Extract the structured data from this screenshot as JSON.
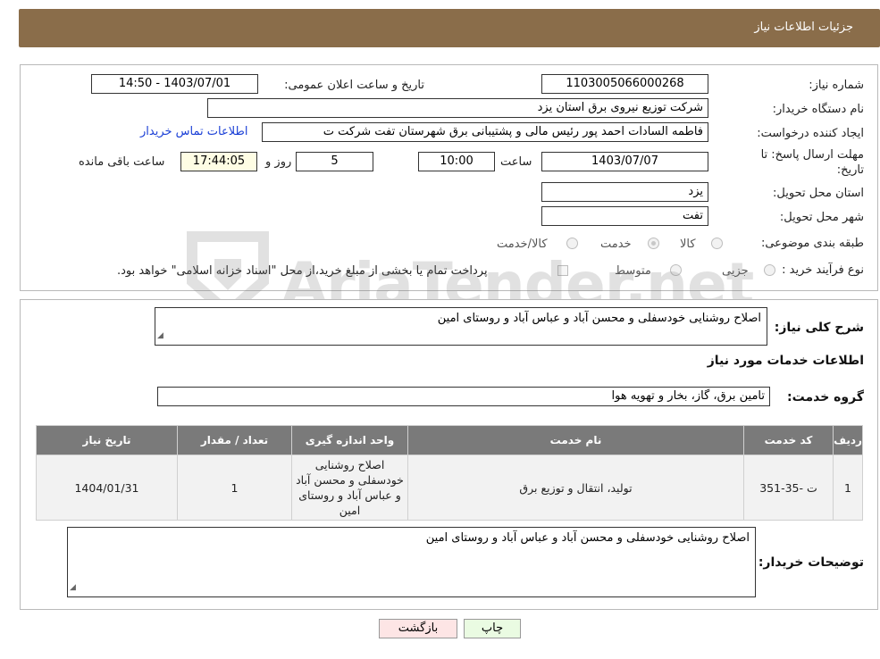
{
  "header": {
    "title": "جزئیات اطلاعات نیاز"
  },
  "form": {
    "need_number_label": "شماره نیاز:",
    "need_number": "1103005066000268",
    "announce_label": "تاریخ و ساعت اعلان عمومی:",
    "announce_value": "1403/07/01 - 14:50",
    "buyer_org_label": "نام دستگاه خریدار:",
    "buyer_org": "شرکت توزیع نیروی برق استان یزد",
    "requester_label": "ایجاد کننده درخواست:",
    "requester": "فاطمه السادات  احمد پور  رئیس مالی و پشتیبانی برق شهرستان تفت شرکت ت",
    "contact_link": "اطلاعات تماس خریدار",
    "deadline_label": "مهلت ارسال پاسخ: تا",
    "deadline_label2": "تاریخ:",
    "deadline_date": "1403/07/07",
    "time_label": "ساعت",
    "deadline_time": "10:00",
    "days_value": "5",
    "days_label": "روز و",
    "remaining_time": "17:44:05",
    "remaining_label": "ساعت باقی مانده",
    "province_label": "استان محل تحویل:",
    "province": "یزد",
    "city_label": "شهر محل تحویل:",
    "city": "تفت",
    "category_label": "طبقه بندی موضوعی:",
    "category_options": [
      "کالا",
      "خدمت",
      "کالا/خدمت"
    ],
    "category_selected": "خدمت",
    "process_label": "نوع فرآیند خرید :",
    "process_options": [
      "جزیی",
      "متوسط"
    ],
    "payment_note": "پرداخت تمام یا بخشی از مبلغ خرید،از محل \"اسناد خزانه اسلامی\" خواهد بود."
  },
  "details": {
    "summary_label": "شرح کلی نیاز:",
    "summary": "اصلاح روشنایی خودسفلی و محسن آباد و عباس آباد و روستای امین",
    "services_title": "اطلاعات خدمات مورد نیاز",
    "service_group_label": "گروه خدمت:",
    "service_group": "تامین برق، گاز، بخار و تهویه هوا",
    "table": {
      "headers": [
        "ردیف",
        "کد خدمت",
        "نام خدمت",
        "واحد اندازه گیری",
        "تعداد / مقدار",
        "تاریخ نیاز"
      ],
      "rows": [
        [
          "1",
          "ت -35-351",
          "تولید، انتقال و توزیع برق",
          "اصلاح روشنایی خودسفلی و محسن آباد و عباس آباد و روستای امین",
          "1",
          "1404/01/31"
        ]
      ]
    },
    "buyer_notes_label": "توضیحات خریدار:",
    "buyer_notes": "اصلاح روشنایی خودسفلی و محسن آباد و عباس آباد و روستای امین"
  },
  "buttons": {
    "print": "چاپ",
    "back": "بازگشت"
  },
  "watermark": {
    "text": "AriaTender.net"
  }
}
